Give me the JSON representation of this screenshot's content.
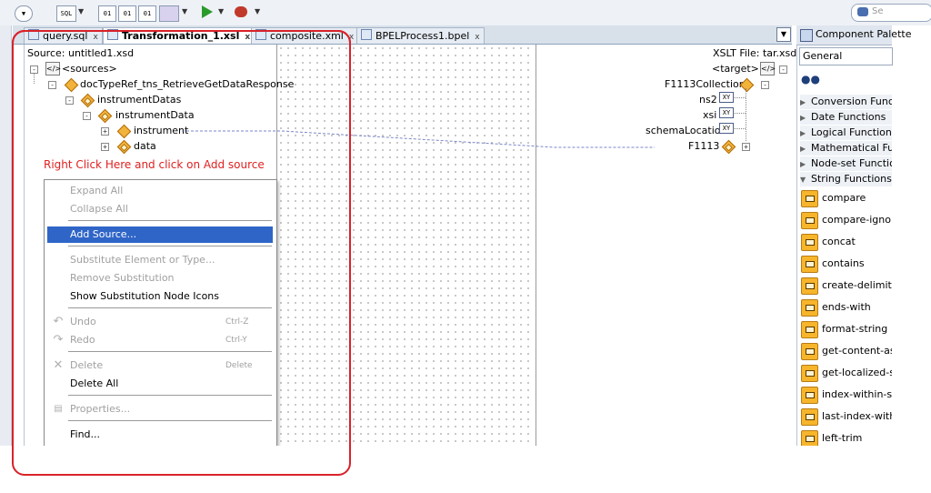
{
  "tabs": [
    {
      "label": "query.sql",
      "close": "x"
    },
    {
      "label": "Transformation_1.xsl",
      "close": "x"
    },
    {
      "label": "composite.xml",
      "close": "x"
    },
    {
      "label": "BPELProcess1.bpel",
      "close": "x"
    }
  ],
  "source": {
    "header": "Source: untitled1.xsd",
    "nodes": [
      "<sources>",
      "docTypeRef_tns_RetrieveGetDataResponse",
      "instrumentDatas",
      "instrumentData",
      "instrument",
      "data"
    ]
  },
  "target": {
    "header": "XSLT File: tar.xsd",
    "nodes": [
      "<target>",
      "F1113Collection",
      "ns2",
      "xsi",
      "schemaLocation",
      "F1113"
    ],
    "attr_icon": "XY"
  },
  "annotation": "Right Click Here and click on Add source",
  "context_menu": {
    "items": [
      {
        "label": "Expand All",
        "shortcut": ""
      },
      {
        "label": "Collapse All",
        "shortcut": ""
      },
      {
        "label": "Add Source...",
        "shortcut": ""
      },
      {
        "label": "Substitute Element or Type...",
        "shortcut": ""
      },
      {
        "label": "Remove Substitution",
        "shortcut": ""
      },
      {
        "label": "Show Substitution Node Icons",
        "shortcut": ""
      },
      {
        "label": "Undo",
        "shortcut": "Ctrl-Z"
      },
      {
        "label": "Redo",
        "shortcut": "Ctrl-Y"
      },
      {
        "label": "Delete",
        "shortcut": "Delete"
      },
      {
        "label": "Delete All",
        "shortcut": ""
      },
      {
        "label": "Properties...",
        "shortcut": ""
      },
      {
        "label": "Find...",
        "shortcut": ""
      }
    ]
  },
  "palette": {
    "title": "Component Palette",
    "selected": "General",
    "categories": [
      "Conversion Functions",
      "Date Functions",
      "Logical Functions",
      "Mathematical Functions",
      "Node-set Functions",
      "String Functions"
    ],
    "functions": [
      "compare",
      "compare-ignore-case",
      "concat",
      "contains",
      "create-delimited-string",
      "ends-with",
      "format-string",
      "get-content-as-string",
      "get-localized-string",
      "index-within-string",
      "last-index-within-string",
      "left-trim"
    ]
  },
  "toolbar": {
    "sql_label": "SQL",
    "search_placeholder": "Se"
  },
  "colors": {
    "annotation": "#e02020",
    "selection": "#2f65c7",
    "accent_icon": "#f7b52c"
  }
}
